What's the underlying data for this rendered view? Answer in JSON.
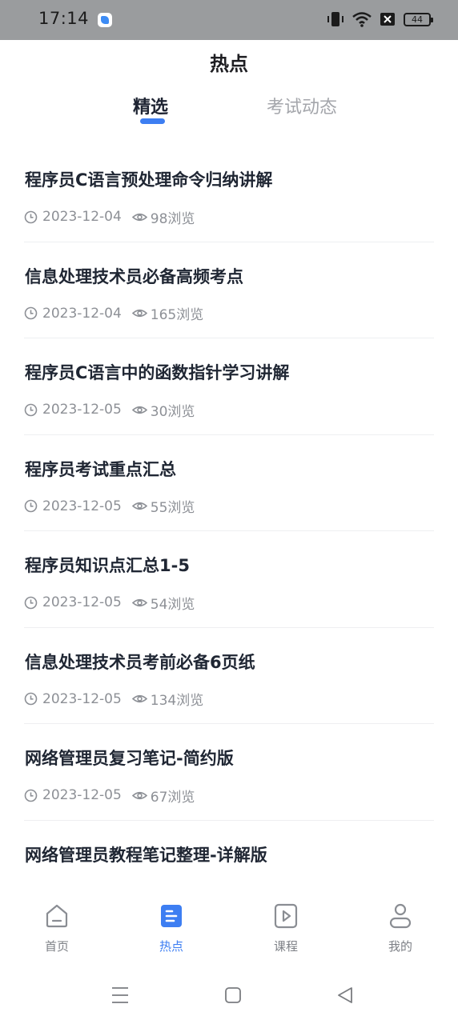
{
  "status_bar": {
    "time": "17:14",
    "battery_level": "44",
    "icons": [
      "app-notification-icon",
      "vibrate-icon",
      "wifi-icon",
      "sim-off-icon",
      "battery-icon"
    ]
  },
  "header": {
    "title": "热点"
  },
  "tabs": [
    {
      "label": "精选",
      "active": true
    },
    {
      "label": "考试动态",
      "active": false
    }
  ],
  "articles": [
    {
      "title": "程序员C语言预处理命令归纳讲解",
      "date": "2023-12-04",
      "views": "98浏览"
    },
    {
      "title": "信息处理技术员必备高频考点",
      "date": "2023-12-04",
      "views": "165浏览"
    },
    {
      "title": "程序员C语言中的函数指针学习讲解",
      "date": "2023-12-05",
      "views": "30浏览"
    },
    {
      "title": "程序员考试重点汇总",
      "date": "2023-12-05",
      "views": "55浏览"
    },
    {
      "title": "程序员知识点汇总1-5",
      "date": "2023-12-05",
      "views": "54浏览"
    },
    {
      "title": "信息处理技术员考前必备6页纸",
      "date": "2023-12-05",
      "views": "134浏览"
    },
    {
      "title": "网络管理员复习笔记-简约版",
      "date": "2023-12-05",
      "views": "67浏览"
    },
    {
      "title": "网络管理员教程笔记整理-详解版",
      "date": "",
      "views": ""
    }
  ],
  "bottom_nav": [
    {
      "label": "首页",
      "icon": "home-icon",
      "active": false
    },
    {
      "label": "热点",
      "icon": "document-icon",
      "active": true
    },
    {
      "label": "课程",
      "icon": "play-icon",
      "active": false
    },
    {
      "label": "我的",
      "icon": "user-icon",
      "active": false
    }
  ],
  "colors": {
    "accent": "#3d7ef2",
    "title_text": "#1f2633",
    "meta_text": "#8d9096",
    "inactive_tab": "#a4a6ab",
    "status_bar_bg": "#9a9c9e"
  }
}
